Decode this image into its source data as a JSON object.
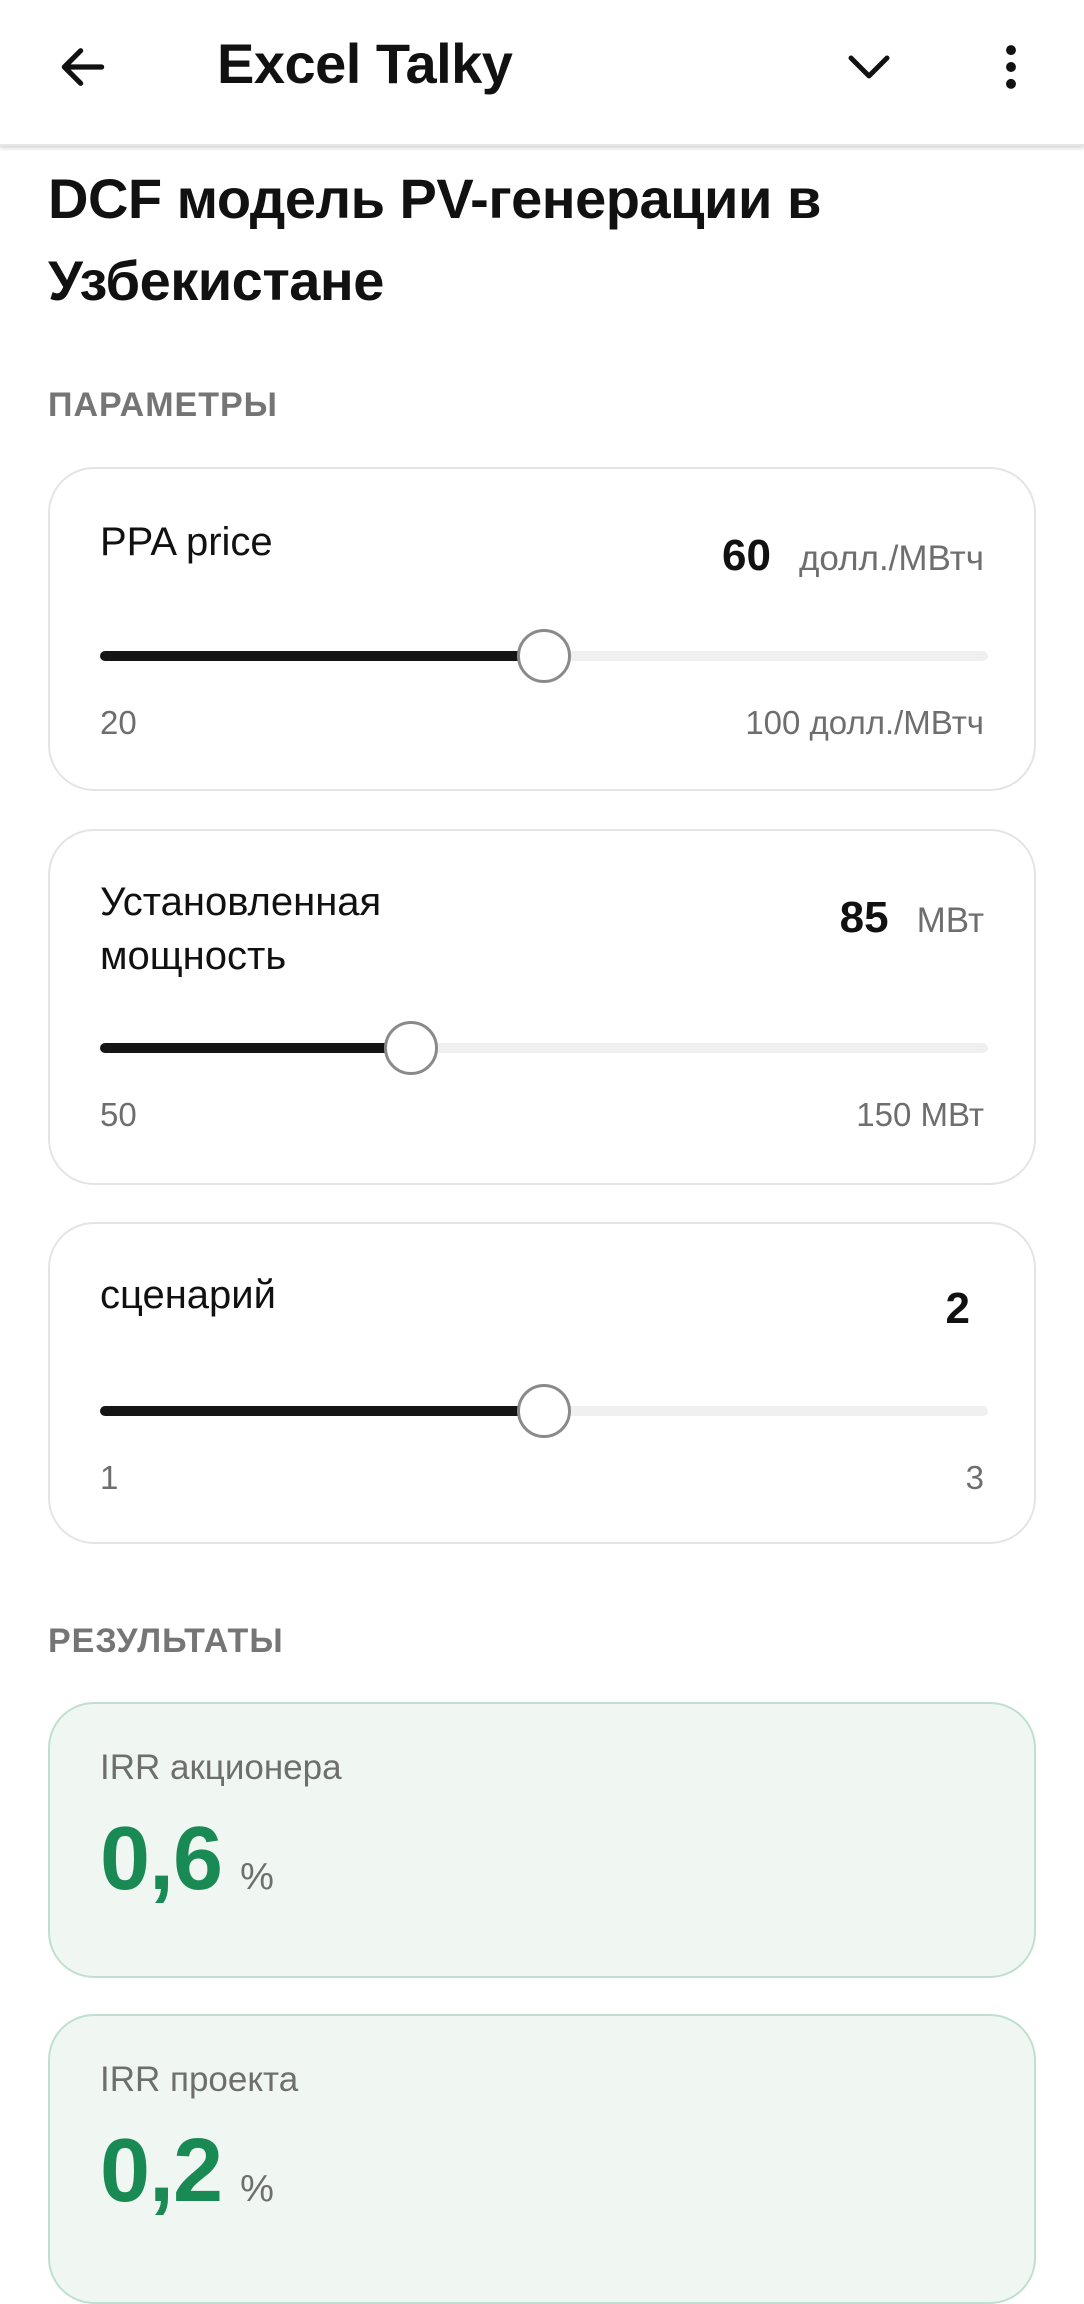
{
  "appbar": {
    "title": "Excel Talky",
    "back_icon": "arrow-left-icon",
    "dropdown_icon": "chevron-down-icon",
    "menu_icon": "more-vertical-icon"
  },
  "page": {
    "title": "DCF модель PV-генерации в Узбекистане"
  },
  "parameters": {
    "section_label": "ПАРАМЕТРЫ",
    "items": [
      {
        "name": "PPA price",
        "value": "60",
        "unit": "долл./МВтч",
        "min_label": "20",
        "max_label": "100 долл./МВтч",
        "min": 20,
        "max": 100,
        "current": 60
      },
      {
        "name": "Установленная мощность",
        "value": "85",
        "unit": "МВт",
        "min_label": "50",
        "max_label": "150 МВт",
        "min": 50,
        "max": 150,
        "current": 85
      },
      {
        "name": "сценарий",
        "value": "2",
        "unit": "",
        "min_label": "1",
        "max_label": "3",
        "min": 1,
        "max": 3,
        "current": 2
      }
    ]
  },
  "results": {
    "section_label": "РЕЗУЛЬТАТЫ",
    "items": [
      {
        "label": "IRR акционера",
        "value": "0,6",
        "unit": "%"
      },
      {
        "label": "IRR проекта",
        "value": "0,2",
        "unit": "%"
      }
    ]
  },
  "colors": {
    "accent_green": "#1a8a55",
    "slider_fill": "#151515",
    "result_bg": "#f0f7f3"
  }
}
